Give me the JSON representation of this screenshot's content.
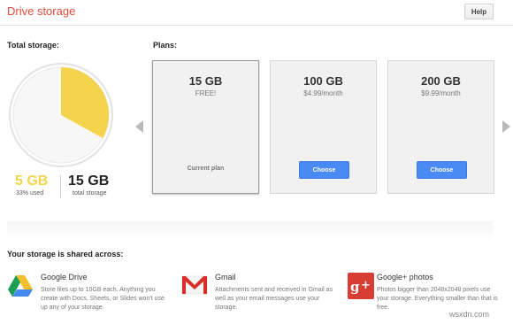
{
  "header": {
    "title": "Drive storage",
    "help_label": "Help"
  },
  "usage": {
    "section_label": "Total storage:",
    "used_value": "5 GB",
    "used_caption": "33% used",
    "used_fraction": 0.33,
    "total_value": "15 GB",
    "total_caption": "total storage",
    "colors": {
      "used": "#f4d44d",
      "free": "#f7f7f7",
      "ring": "#e3e3e3"
    }
  },
  "plans": {
    "section_label": "Plans:",
    "items": [
      {
        "size": "15 GB",
        "price": "FREE!",
        "status": "Current plan"
      },
      {
        "size": "100 GB",
        "price": "$4.99/month",
        "button": "Choose"
      },
      {
        "size": "200 GB",
        "price": "$9.99/month",
        "button": "Choose"
      }
    ]
  },
  "shared": {
    "section_label": "Your storage is shared across:",
    "services": [
      {
        "icon": "google-drive-icon",
        "name": "Google Drive",
        "description": "Store files up to 10GB each. Anything you create with Docs, Sheets, or Slides won't use up any of your storage."
      },
      {
        "icon": "gmail-icon",
        "name": "Gmail",
        "description": "Attachments sent and received in Gmail as well as your email messages use your storage."
      },
      {
        "icon": "google-plus-icon",
        "name": "Google+ photos",
        "description": "Photos bigger than 2048x2048 pixels use your storage. Everything smaller than that is free."
      }
    ]
  },
  "watermark": "wsxdn.com"
}
